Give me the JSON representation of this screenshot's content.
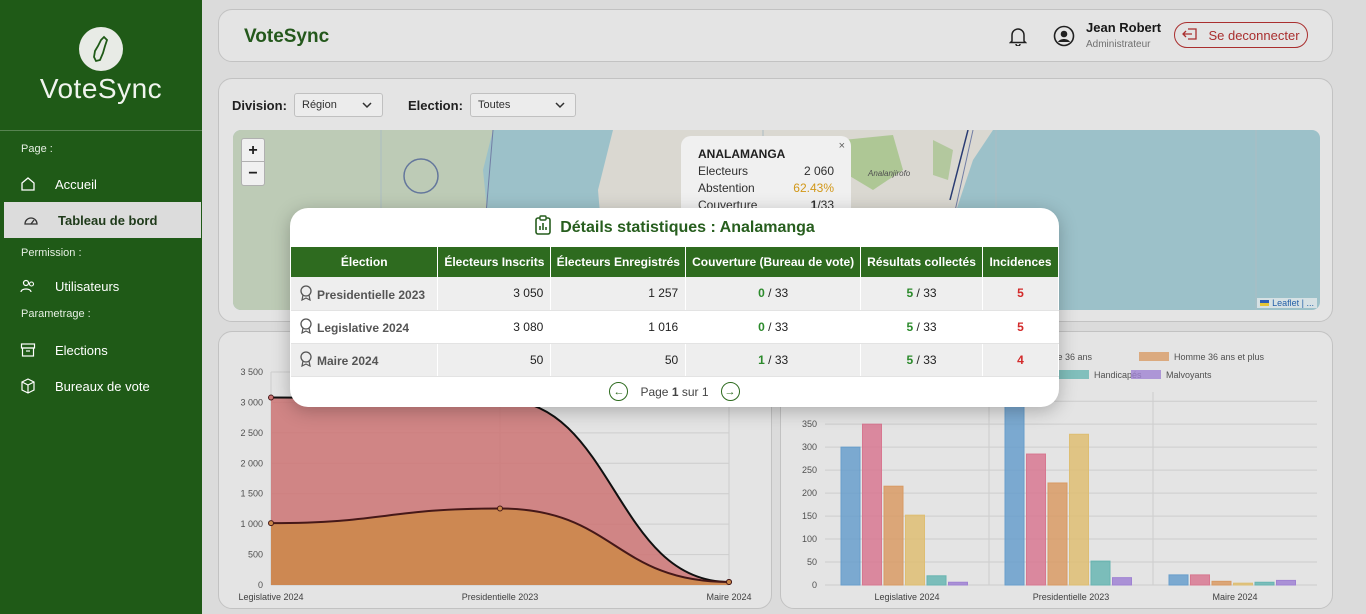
{
  "app": {
    "name": "VoteSync"
  },
  "sidebar": {
    "sections": [
      {
        "label": "Page :",
        "items": [
          {
            "label": "Accueil"
          },
          {
            "label": "Tableau de bord"
          }
        ]
      },
      {
        "label": "Permission :",
        "items": [
          {
            "label": "Utilisateurs"
          }
        ]
      },
      {
        "label": "Parametrage :",
        "items": [
          {
            "label": "Elections"
          },
          {
            "label": "Bureaux de vote"
          }
        ]
      }
    ]
  },
  "header": {
    "title": "VoteSync",
    "user_name": "Jean Robert",
    "user_role": "Administrateur",
    "logout_label": "Se deconnecter"
  },
  "filters": {
    "division_label": "Division:",
    "division_value": "Région",
    "election_label": "Election:",
    "election_value": "Toutes"
  },
  "map": {
    "zoom_in": "+",
    "zoom_out": "−",
    "attribution": "Leaflet | ...",
    "place_label": "Analanjirofo",
    "popup": {
      "title": "ANALAMANGA",
      "rows": [
        {
          "label": "Electeurs",
          "value": "2 060"
        },
        {
          "label": "Abstention",
          "value": "62.43%"
        },
        {
          "label": "Couverture",
          "value": "1",
          "suffix": "/33"
        }
      ],
      "close": "×"
    }
  },
  "modal": {
    "title": "Détails statistiques : Analamanga",
    "columns": [
      "Élection",
      "Électeurs Inscrits",
      "Électeurs Enregistrés",
      "Couverture (Bureau de vote)",
      "Résultats collectés",
      "Incidences"
    ],
    "rows": [
      {
        "election": "Presidentielle 2023",
        "inscrits": "3 050",
        "enregistres": "1 257",
        "couverture": "0",
        "couverture_total": " / 33",
        "resultats": "5",
        "resultats_total": " / 33",
        "incidences": "5"
      },
      {
        "election": "Legislative 2024",
        "inscrits": "3 080",
        "enregistres": "1 016",
        "couverture": "0",
        "couverture_total": " / 33",
        "resultats": "5",
        "resultats_total": " / 33",
        "incidences": "5"
      },
      {
        "election": "Maire 2024",
        "inscrits": "50",
        "enregistres": "50",
        "couverture": "1",
        "couverture_total": " / 33",
        "resultats": "5",
        "resultats_total": " / 33",
        "incidences": "4"
      }
    ],
    "pager": {
      "prefix": "Page ",
      "current": "1",
      "sep": " sur ",
      "total": "1"
    }
  },
  "chart_data": [
    {
      "type": "area",
      "categories": [
        "Legislative 2024",
        "Presidentielle 2023",
        "Maire 2024"
      ],
      "series": [
        {
          "values": [
            3080,
            3050,
            50
          ],
          "color": "#d97b7b"
        },
        {
          "values": [
            1016,
            1257,
            50
          ],
          "color": "#d9924f"
        }
      ],
      "ylim": [
        0,
        3500
      ],
      "yticks": [
        "0",
        "500",
        "1 000",
        "1 500",
        "2 000",
        "2 500",
        "3 000",
        "3 500"
      ]
    },
    {
      "type": "bar",
      "categories": [
        "Legislative 2024",
        "Presidentielle 2023",
        "Maire 2024"
      ],
      "legend": [
        "... moins de 36 ans",
        "Homme 36 ans et plus",
        "Handicapés",
        "Malvoyants"
      ],
      "series": [
        {
          "color": "#6fa8d8",
          "values": [
            300,
            420,
            22
          ]
        },
        {
          "color": "#e57f9a",
          "values": [
            350,
            285,
            22
          ]
        },
        {
          "color": "#e6a56b",
          "values": [
            215,
            222,
            8
          ]
        },
        {
          "color": "#ecca7a",
          "values": [
            152,
            328,
            4
          ]
        },
        {
          "color": "#6fc1bd",
          "values": [
            20,
            52,
            6
          ]
        },
        {
          "color": "#a98be0",
          "values": [
            6,
            16,
            10
          ]
        }
      ],
      "ylim": [
        0,
        420
      ],
      "yticks": [
        "0",
        "50",
        "100",
        "150",
        "200",
        "250",
        "300",
        "350",
        "400"
      ]
    }
  ]
}
